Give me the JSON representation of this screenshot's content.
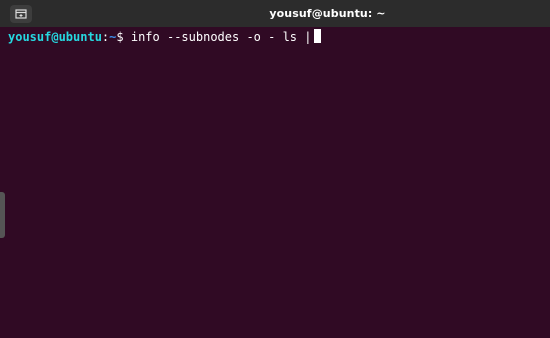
{
  "window": {
    "title": "yousuf@ubuntu: ~"
  },
  "titlebar": {
    "new_tab_icon": "new-tab-icon"
  },
  "terminal": {
    "prompt_user_host": "yousuf@ubuntu",
    "prompt_separator": ":",
    "prompt_path": "~",
    "prompt_symbol": "$",
    "command": "info --subnodes -o - ls |"
  },
  "colors": {
    "background": "#300a24",
    "titlebar": "#2c2c2c",
    "prompt_user": "#26d8e0",
    "prompt_path": "#3b8eea",
    "text": "#ffffff"
  }
}
